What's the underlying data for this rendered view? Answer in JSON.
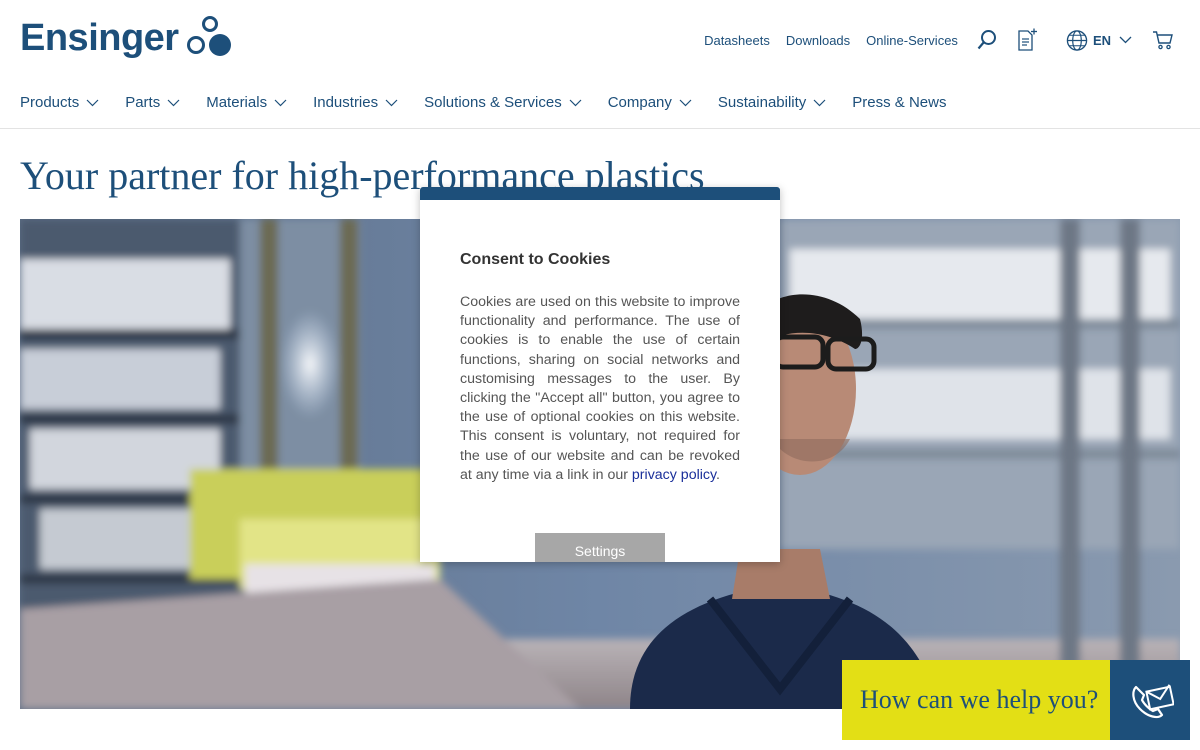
{
  "brand": {
    "logo_text": "Ensinger",
    "primary_color": "#1d4f7a",
    "accent_color": "#e3df15"
  },
  "utility_nav": {
    "links": [
      "Datasheets",
      "Downloads",
      "Online-Services"
    ],
    "language": "EN",
    "icons": [
      "search-icon",
      "document-add-icon",
      "globe-icon",
      "chevron-down-icon",
      "cart-icon"
    ]
  },
  "main_nav": {
    "items": [
      {
        "label": "Products",
        "has_dropdown": true
      },
      {
        "label": "Parts",
        "has_dropdown": true
      },
      {
        "label": "Materials",
        "has_dropdown": true
      },
      {
        "label": "Industries",
        "has_dropdown": true
      },
      {
        "label": "Solutions & Services",
        "has_dropdown": true
      },
      {
        "label": "Company",
        "has_dropdown": true
      },
      {
        "label": "Sustainability",
        "has_dropdown": true
      },
      {
        "label": "Press & News",
        "has_dropdown": false
      }
    ]
  },
  "hero": {
    "title": "Your partner for high-performance plastics"
  },
  "cookie_modal": {
    "title": "Consent to Cookies",
    "body": "Cookies are used on this website to improve functionality and performance. The use of cookies is to enable the use of certain functions, sharing on social networks and customising messages to the user. By clicking the \"Accept all\" button, you agree to the use of optional cookies on this website. This consent is voluntary, not required for the use of our website and can be revoked at any time via a link in our",
    "link_text": "privacy policy",
    "settings_label": "Settings",
    "header_bar_color": "#1d4f7a",
    "button_color": "#a7a7a7"
  },
  "help_widget": {
    "text": "How can we help you?",
    "icon": "phone-mail-icon"
  }
}
